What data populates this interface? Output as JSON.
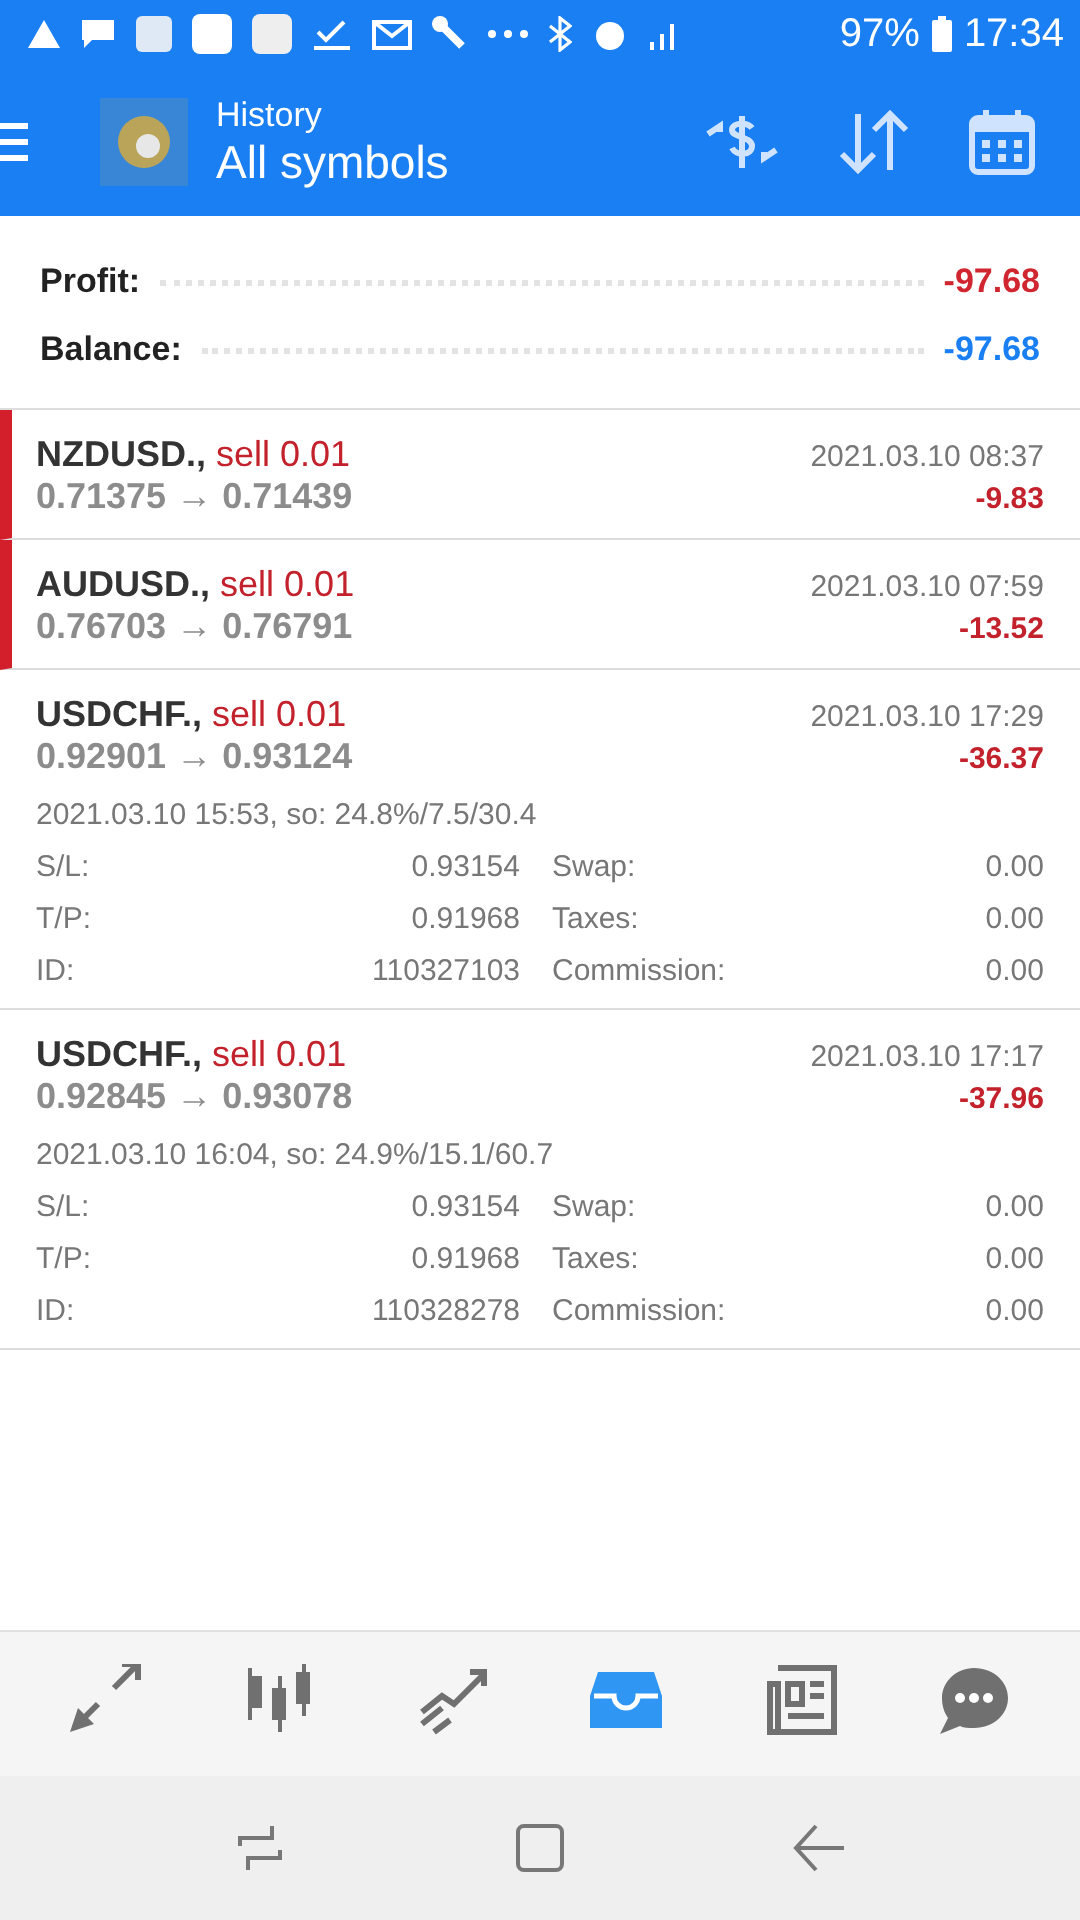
{
  "status_bar": {
    "battery": "97%",
    "time": "17:34"
  },
  "header": {
    "title": "History",
    "subtitle": "All symbols"
  },
  "summary": [
    {
      "label": "Profit:",
      "value": "-97.68",
      "kind": "loss"
    },
    {
      "label": "Balance:",
      "value": "-97.68",
      "kind": "balance"
    }
  ],
  "deals": [
    {
      "symbol": "NZDUSD.,",
      "side": "sell 0.01",
      "prices": "0.71375 → 0.71439",
      "time": "2021.03.10 08:37",
      "profit": "-9.83",
      "highlighted": true,
      "expanded": false
    },
    {
      "symbol": "AUDUSD.,",
      "side": "sell 0.01",
      "prices": "0.76703 → 0.76791",
      "time": "2021.03.10 07:59",
      "profit": "-13.52",
      "highlighted": true,
      "expanded": false
    },
    {
      "symbol": "USDCHF.,",
      "side": "sell 0.01",
      "prices": "0.92901 → 0.93124",
      "time": "2021.03.10 17:29",
      "profit": "-36.37",
      "highlighted": false,
      "expanded": true,
      "info": "2021.03.10 15:53, so: 24.8%/7.5/30.4",
      "details": [
        [
          "S/L:",
          "0.93154",
          "Swap:",
          "0.00"
        ],
        [
          "T/P:",
          "0.91968",
          "Taxes:",
          "0.00"
        ],
        [
          "ID:",
          "110327103",
          "Commission:",
          "0.00"
        ]
      ]
    },
    {
      "symbol": "USDCHF.,",
      "side": "sell 0.01",
      "prices": "0.92845 → 0.93078",
      "time": "2021.03.10 17:17",
      "profit": "-37.96",
      "highlighted": false,
      "expanded": true,
      "info": "2021.03.10 16:04, so: 24.9%/15.1/60.7",
      "details": [
        [
          "S/L:",
          "0.93154",
          "Swap:",
          "0.00"
        ],
        [
          "T/P:",
          "0.91968",
          "Taxes:",
          "0.00"
        ],
        [
          "ID:",
          "110328278",
          "Commission:",
          "0.00"
        ]
      ]
    }
  ],
  "bottom_nav": [
    {
      "selected": false
    },
    {
      "selected": false
    },
    {
      "selected": false
    },
    {
      "selected": true
    },
    {
      "selected": false
    },
    {
      "selected": false
    }
  ]
}
